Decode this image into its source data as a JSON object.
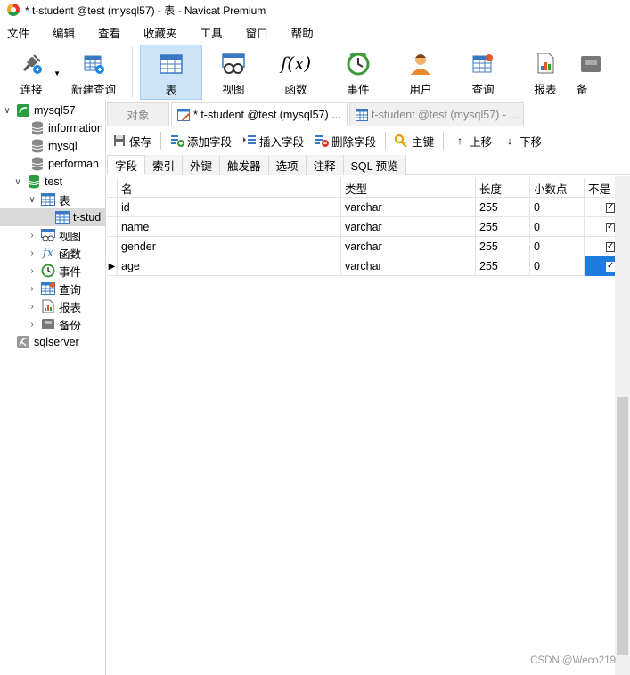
{
  "window": {
    "title": "* t-student @test (mysql57) - 表 - Navicat Premium"
  },
  "menu": [
    "文件",
    "编辑",
    "查看",
    "收藏夹",
    "工具",
    "窗口",
    "帮助"
  ],
  "toolbar": {
    "buttons": [
      {
        "label": "连接",
        "icon": "plug-icon"
      },
      {
        "label": "新建查询",
        "icon": "new-query-icon"
      },
      {
        "label": "表",
        "icon": "table-icon",
        "active": true
      },
      {
        "label": "视图",
        "icon": "view-icon"
      },
      {
        "label": "函数",
        "icon": "function-icon"
      },
      {
        "label": "事件",
        "icon": "clock-icon"
      },
      {
        "label": "用户",
        "icon": "user-icon"
      },
      {
        "label": "查询",
        "icon": "query-icon"
      },
      {
        "label": "报表",
        "icon": "report-icon"
      },
      {
        "label": "备",
        "icon": "backup-icon"
      }
    ]
  },
  "sidebar": {
    "conn_mysql": "mysql57",
    "db_information": "information",
    "db_mysql": "mysql",
    "db_performance": "performan",
    "db_test": "test",
    "tables_label": "表",
    "table_student": "t-stud",
    "views_label": "视图",
    "functions_label": "函数",
    "events_label": "事件",
    "queries_label": "查询",
    "reports_label": "报表",
    "backups_label": "备份",
    "conn_sqlserver": "sqlserver"
  },
  "tabs": {
    "objects": "对象",
    "design_tab": "* t-student @test (mysql57) ...",
    "data_tab": "t-student @test (mysql57) - ..."
  },
  "object_toolbar": {
    "save": "保存",
    "add_field": "添加字段",
    "insert_field": "插入字段",
    "delete_field": "删除字段",
    "primary_key": "主键",
    "move_up": "上移",
    "move_down": "下移"
  },
  "subtabs": [
    "字段",
    "索引",
    "外键",
    "触发器",
    "选项",
    "注释",
    "SQL 预览"
  ],
  "grid": {
    "headers": {
      "name": "名",
      "type": "类型",
      "length": "长度",
      "decimals": "小数点",
      "not_null": "不是"
    },
    "rows": [
      {
        "name": "id",
        "type": "varchar",
        "length": "255",
        "decimals": "0",
        "not_null": true
      },
      {
        "name": "name",
        "type": "varchar",
        "length": "255",
        "decimals": "0",
        "not_null": true
      },
      {
        "name": "gender",
        "type": "varchar",
        "length": "255",
        "decimals": "0",
        "not_null": true
      },
      {
        "name": "age",
        "type": "varchar",
        "length": "255",
        "decimals": "0",
        "not_null": true
      }
    ],
    "current_row_marker": "▶"
  },
  "watermark": "CSDN @Weco219",
  "colors": {
    "accent_selected": "#1e7be0",
    "toolbar_active": "#cde3f7"
  }
}
